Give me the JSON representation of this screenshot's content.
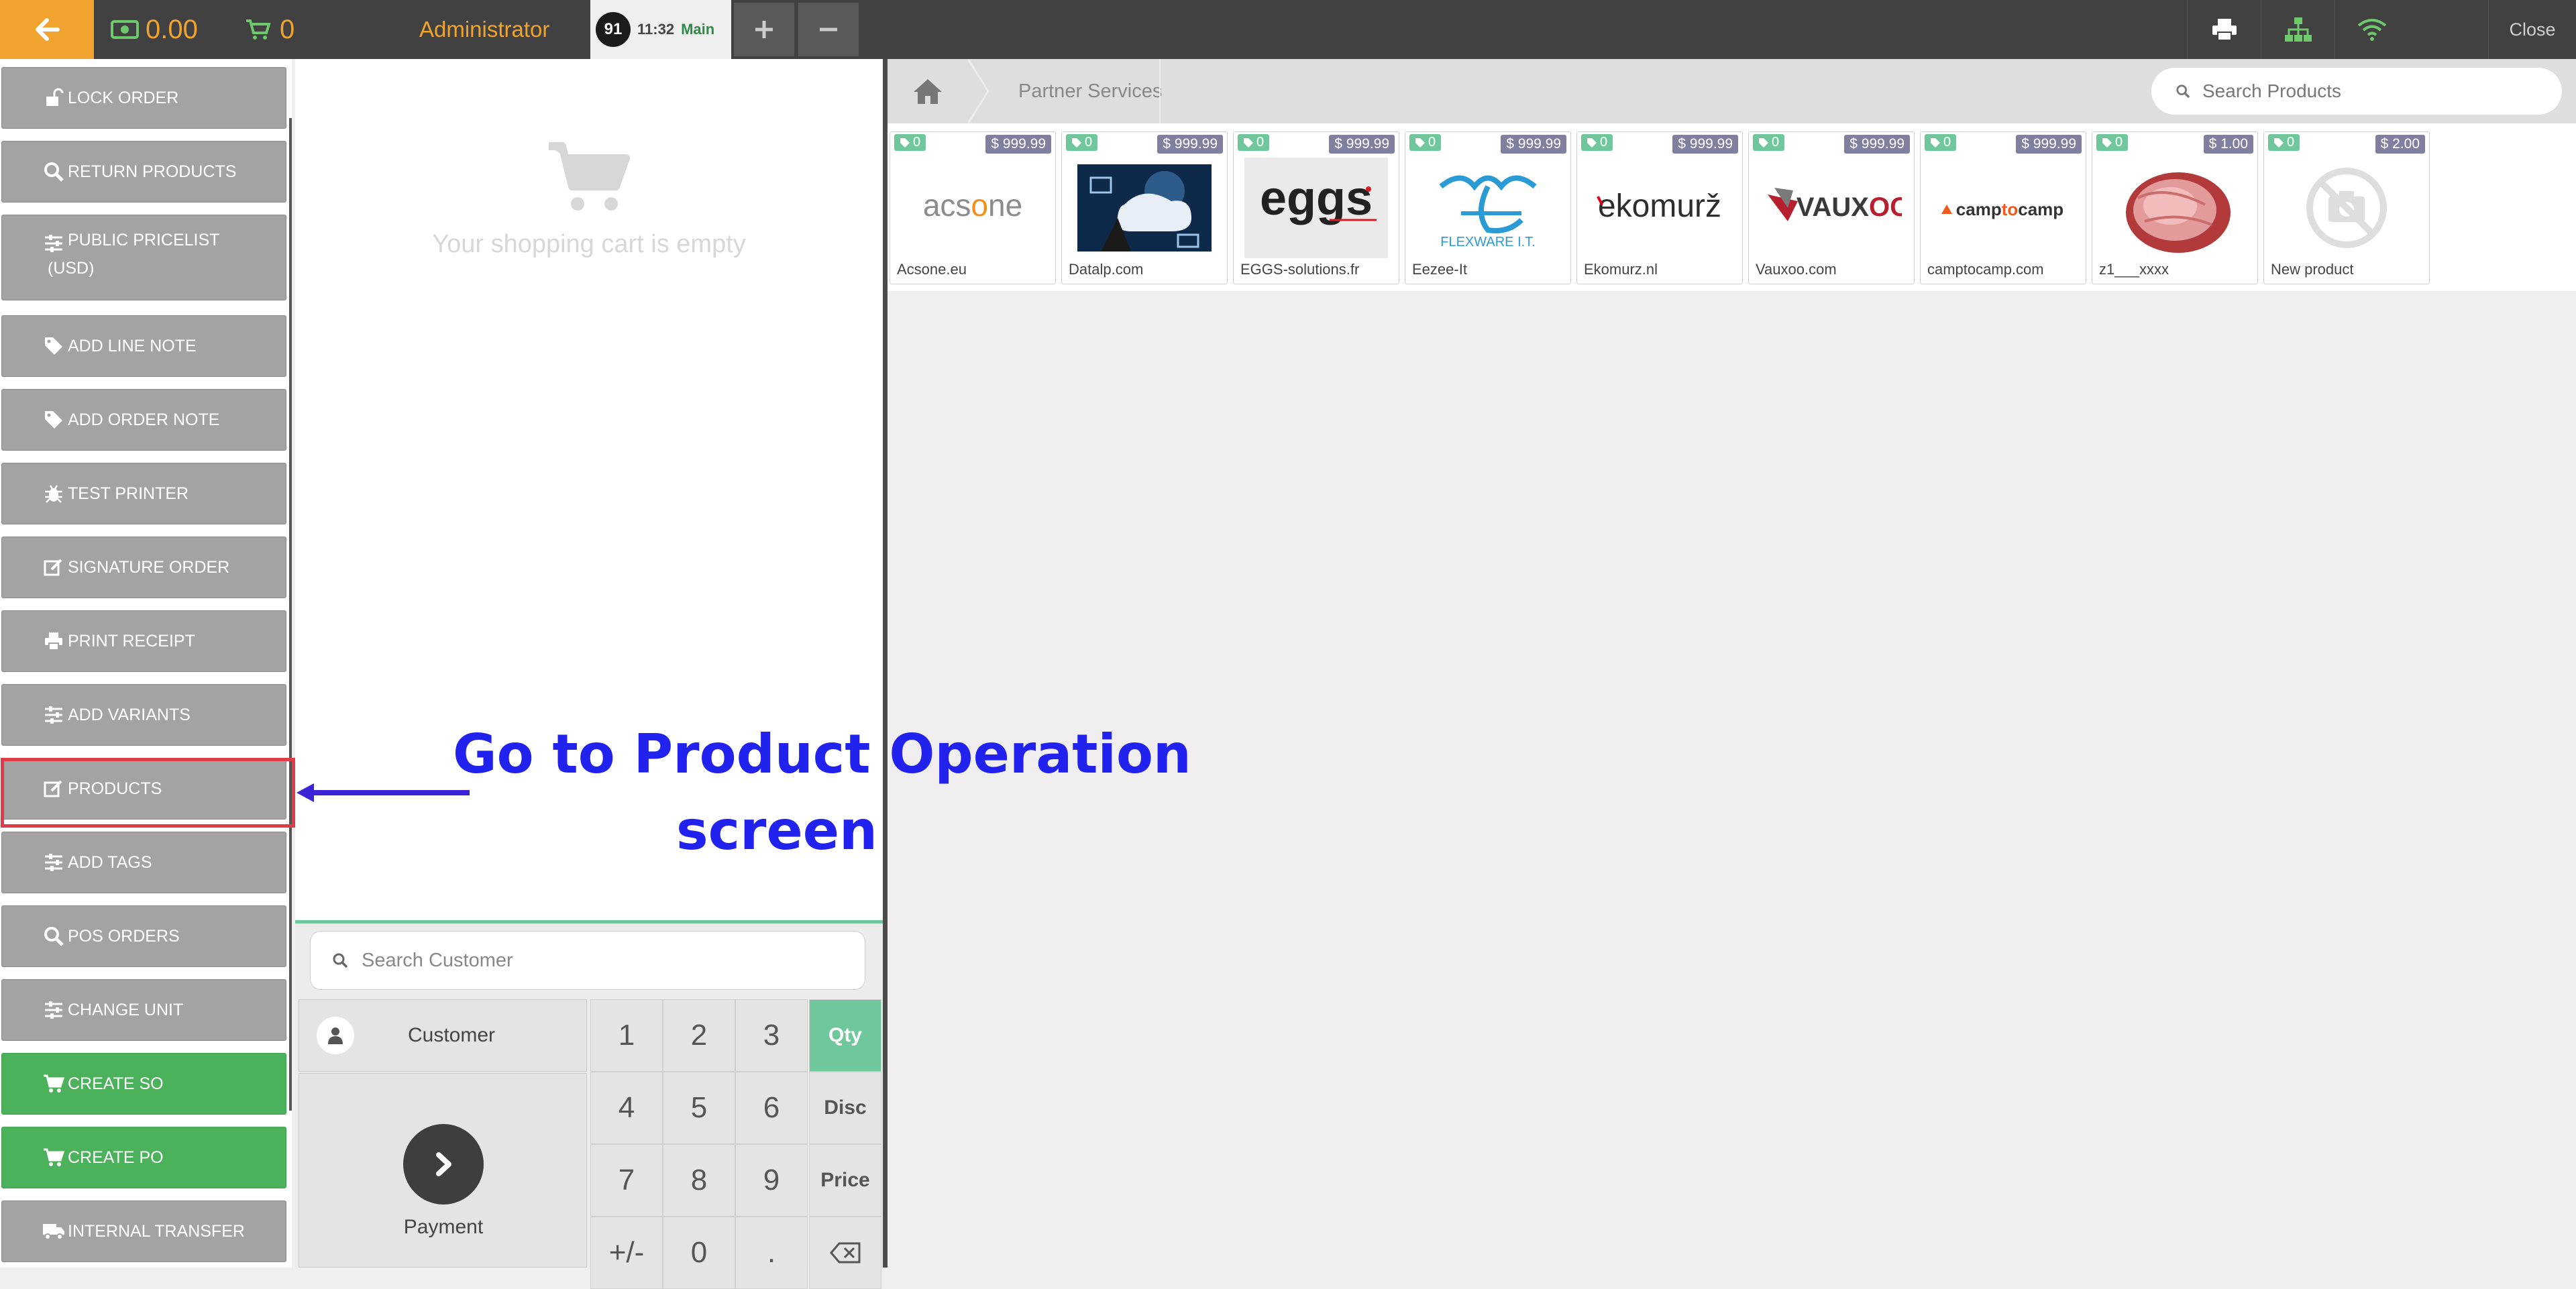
{
  "topbar": {
    "cash_value": "0.00",
    "cart_count": "0",
    "user": "Administrator",
    "order_number": "91",
    "order_time": "11:32",
    "order_label": "Main",
    "close_label": "Close",
    "accent_color": "#f0a32f"
  },
  "actions": {
    "lock_order": "LOCK ORDER",
    "return_products": "RETURN PRODUCTS",
    "public_pricelist_1": "PUBLIC PRICELIST",
    "public_pricelist_2": "(USD)",
    "add_line_note": "ADD LINE NOTE",
    "add_order_note": "ADD ORDER NOTE",
    "test_printer": "TEST PRINTER",
    "signature_order": "SIGNATURE ORDER",
    "print_receipt": "PRINT RECEIPT",
    "add_variants": "ADD VARIANTS",
    "products": "PRODUCTS",
    "add_tags": "ADD TAGS",
    "pos_orders": "POS ORDERS",
    "change_unit": "CHANGE UNIT",
    "create_so": "CREATE SO",
    "create_po": "CREATE PO",
    "internal_transfer": "INTERNAL TRANSFER"
  },
  "cart": {
    "empty_text": "Your shopping cart is empty"
  },
  "customer": {
    "search_placeholder": "Search Customer",
    "button_label": "Customer"
  },
  "payment": {
    "label": "Payment"
  },
  "numpad": {
    "keys": [
      "1",
      "2",
      "3",
      "4",
      "5",
      "6",
      "7",
      "8",
      "9",
      "+/-",
      "0",
      "."
    ],
    "modes": [
      "Qty",
      "Disc",
      "Price"
    ],
    "active_mode": "Qty"
  },
  "breadcrumb": {
    "category": "Partner Services"
  },
  "product_search": {
    "placeholder": "Search Products"
  },
  "products": [
    {
      "name": "Acsone.eu",
      "price": "$ 999.99",
      "tag": "0",
      "logo": "acsone"
    },
    {
      "name": "Datalp.com",
      "price": "$ 999.99",
      "tag": "0",
      "logo": "datalp"
    },
    {
      "name": "EGGS-solutions.fr",
      "price": "$ 999.99",
      "tag": "0",
      "logo": "eggs"
    },
    {
      "name": "Eezee-It",
      "price": "$ 999.99",
      "tag": "0",
      "logo": "eezee",
      "logo_caption": "FLEXWARE I.T."
    },
    {
      "name": "Ekomurz.nl",
      "price": "$ 999.99",
      "tag": "0",
      "logo": "ekomurz"
    },
    {
      "name": "Vauxoo.com",
      "price": "$ 999.99",
      "tag": "0",
      "logo": "vauxoo"
    },
    {
      "name": "camptocamp.com",
      "price": "$ 999.99",
      "tag": "0",
      "logo": "camptocamp"
    },
    {
      "name": "z1___xxxx",
      "price": "$ 1.00",
      "tag": "0",
      "logo": "ham"
    },
    {
      "name": "New product",
      "price": "$ 2.00",
      "tag": "0",
      "logo": "no-image"
    }
  ],
  "annotation": {
    "line1": "Go to Product Operation",
    "line2": "screen",
    "color": "#2222ee",
    "highlight_color": "#e23b48"
  }
}
